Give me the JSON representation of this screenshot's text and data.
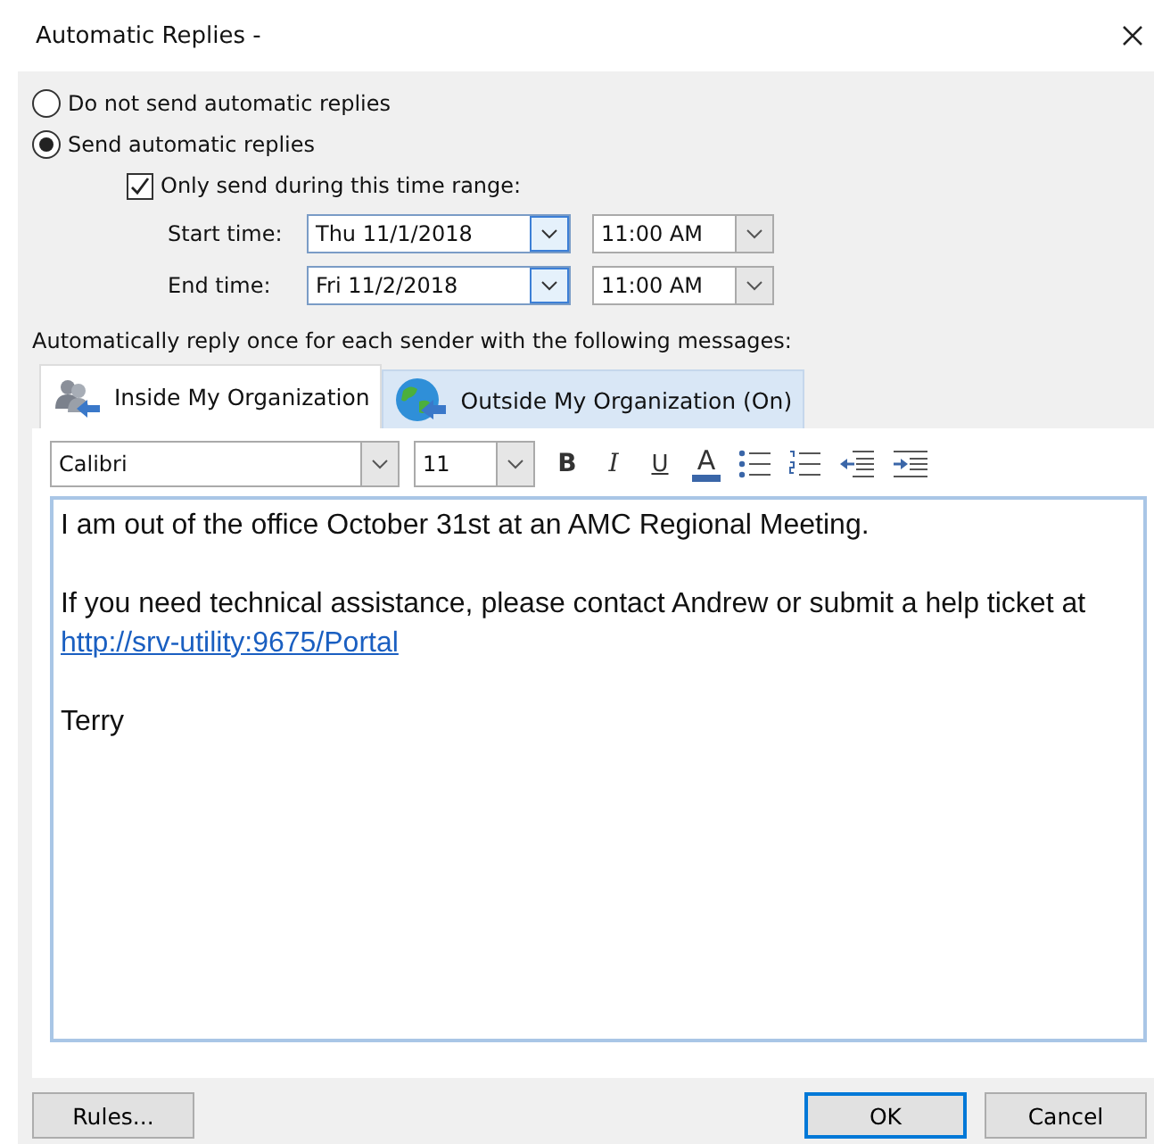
{
  "window": {
    "title": "Automatic Replies -"
  },
  "reply_mode": [
    {
      "label": "Do not send automatic replies",
      "selected": false
    },
    {
      "label": "Send automatic replies",
      "selected": true
    }
  ],
  "time_range": {
    "label": "Only send during this time range:",
    "checked": true,
    "rows": [
      {
        "label": "Start time:",
        "date": "Thu 11/1/2018",
        "time": "11:00 AM"
      },
      {
        "label": "End time:",
        "date": "Fri 11/2/2018",
        "time": "11:00 AM"
      }
    ]
  },
  "instructions": "Automatically reply once for each sender with the following messages:",
  "tabs": [
    {
      "label": "Inside My Organization",
      "kind": "people",
      "selected": true
    },
    {
      "label": "Outside My Organization (On)",
      "kind": "globe",
      "selected": false
    }
  ],
  "toolbar": {
    "font": "Calibri",
    "size": "11",
    "buttons": [
      {
        "kind": "bold",
        "label": "B"
      },
      {
        "kind": "italic",
        "label": "I"
      },
      {
        "kind": "underline",
        "label": "U"
      },
      {
        "kind": "color",
        "label": "A"
      },
      {
        "kind": "bullets"
      },
      {
        "kind": "numbering"
      },
      {
        "kind": "outdent"
      },
      {
        "kind": "indent"
      }
    ]
  },
  "message": [
    {
      "text": "I am out of the office October 31st at an AMC Regional Meeting."
    },
    {
      "text": "If you need technical assistance, please contact Andrew or submit a help ticket at ",
      "link": "http://srv-utility:9675/Portal"
    },
    {
      "text": "Terry"
    }
  ],
  "buttons": [
    {
      "label": "Rules...",
      "kind": "rules"
    },
    {
      "label": "OK",
      "kind": "ok"
    },
    {
      "label": "Cancel",
      "kind": "cancel"
    }
  ]
}
